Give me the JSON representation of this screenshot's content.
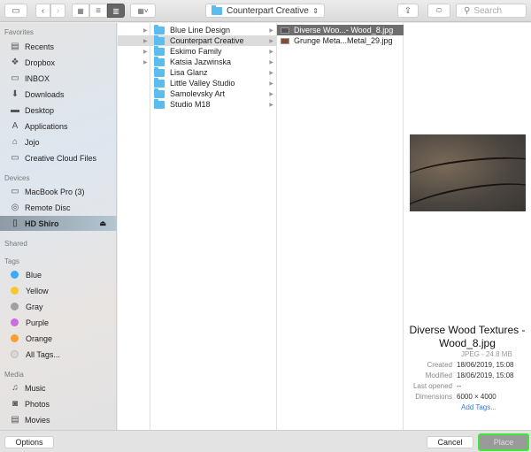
{
  "toolbar": {
    "path_label": "Counterpart Creative",
    "search_placeholder": "Search"
  },
  "sidebar": {
    "favorites_header": "Favorites",
    "favorites": [
      {
        "label": "Recents",
        "icon": "recents-icon"
      },
      {
        "label": "Dropbox",
        "icon": "dropbox-icon"
      },
      {
        "label": "INBOX",
        "icon": "folder-icon"
      },
      {
        "label": "Downloads",
        "icon": "downloads-icon"
      },
      {
        "label": "Desktop",
        "icon": "desktop-icon"
      },
      {
        "label": "Applications",
        "icon": "applications-icon"
      },
      {
        "label": "Jojo",
        "icon": "home-icon"
      },
      {
        "label": "Creative Cloud Files",
        "icon": "folder-icon"
      }
    ],
    "devices_header": "Devices",
    "devices": [
      {
        "label": "MacBook Pro (3)",
        "icon": "laptop-icon"
      },
      {
        "label": "Remote Disc",
        "icon": "disc-icon"
      },
      {
        "label": "HD Shiro",
        "icon": "drive-icon",
        "selected": true
      }
    ],
    "shared_header": "Shared",
    "tags_header": "Tags",
    "tags": [
      {
        "label": "Blue",
        "color": "#3fa9f5"
      },
      {
        "label": "Yellow",
        "color": "#f7c82e"
      },
      {
        "label": "Gray",
        "color": "#a0a0a0"
      },
      {
        "label": "Purple",
        "color": "#c86ee0"
      },
      {
        "label": "Orange",
        "color": "#f7a030"
      },
      {
        "label": "All Tags...",
        "color": "#d8d8d8"
      }
    ],
    "media_header": "Media",
    "media": [
      {
        "label": "Music",
        "icon": "music-icon"
      },
      {
        "label": "Photos",
        "icon": "camera-icon"
      },
      {
        "label": "Movies",
        "icon": "film-icon"
      }
    ]
  },
  "column2": {
    "items": [
      {
        "label": "Blue Line Design"
      },
      {
        "label": "Counterpart Creative",
        "selected": true
      },
      {
        "label": "Eskimo Family"
      },
      {
        "label": "Katsia Jazwinska"
      },
      {
        "label": "Lisa Glanz"
      },
      {
        "label": "Little Valley Studio"
      },
      {
        "label": "Samolevsky Art"
      },
      {
        "label": "Studio M18"
      }
    ]
  },
  "column3": {
    "items": [
      {
        "label": "Diverse Woo...- Wood_8.jpg",
        "selected": true
      },
      {
        "label": "Grunge Meta...Metal_29.jpg"
      }
    ]
  },
  "preview": {
    "title": "Diverse Wood Textures - Wood_8.jpg",
    "kind": "JPEG - 24.8 MB",
    "meta": [
      {
        "key": "Created",
        "value": "18/06/2019, 15:08"
      },
      {
        "key": "Modified",
        "value": "18/06/2019, 15:08"
      },
      {
        "key": "Last opened",
        "value": "--"
      },
      {
        "key": "Dimensions",
        "value": "6000 × 4000"
      }
    ],
    "add_tags": "Add Tags...",
    "accent": "#2f7de1"
  },
  "bottom": {
    "options": "Options",
    "cancel": "Cancel",
    "place": "Place"
  }
}
